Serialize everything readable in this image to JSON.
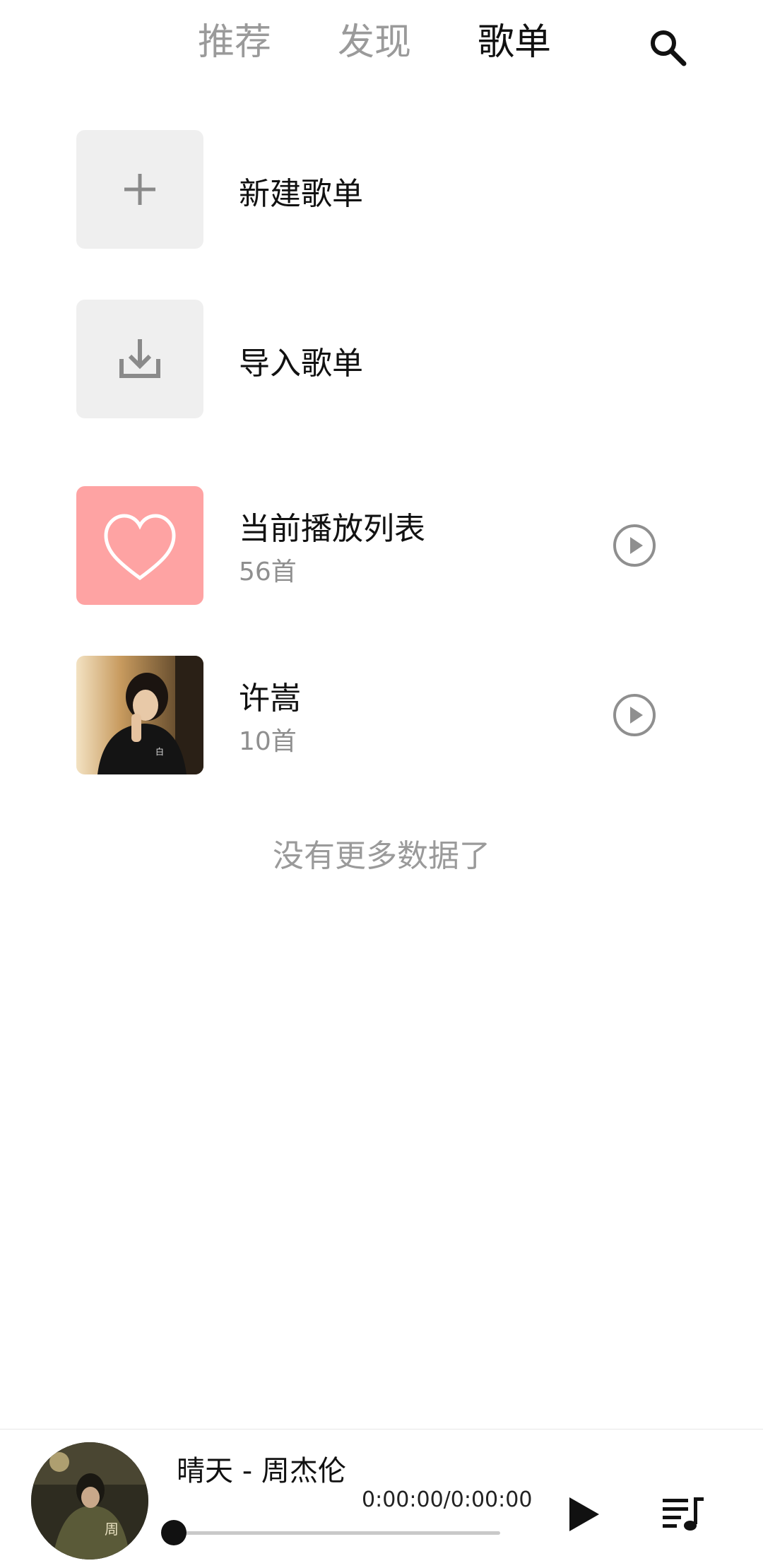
{
  "tabs": [
    {
      "label": "推荐",
      "active": false
    },
    {
      "label": "发现",
      "active": false
    },
    {
      "label": "歌单",
      "active": true
    }
  ],
  "actions": {
    "new_playlist": "新建歌单",
    "import_playlist": "导入歌单"
  },
  "playlists": [
    {
      "title": "当前播放列表",
      "count": "56首",
      "cover": "heart-icon",
      "cover_color": "#fea3a3"
    },
    {
      "title": "许嵩",
      "count": "10首",
      "cover": "album-photo"
    }
  ],
  "list_end_text": "没有更多数据了",
  "player": {
    "song": "晴天 - 周杰伦",
    "time": "0:00:00/0:00:00",
    "progress": 0
  },
  "colors": {
    "accent_text": "#111111",
    "muted_text": "#9a9a9a",
    "tile_bg": "#efefef",
    "heart_tile": "#fea3a3"
  }
}
